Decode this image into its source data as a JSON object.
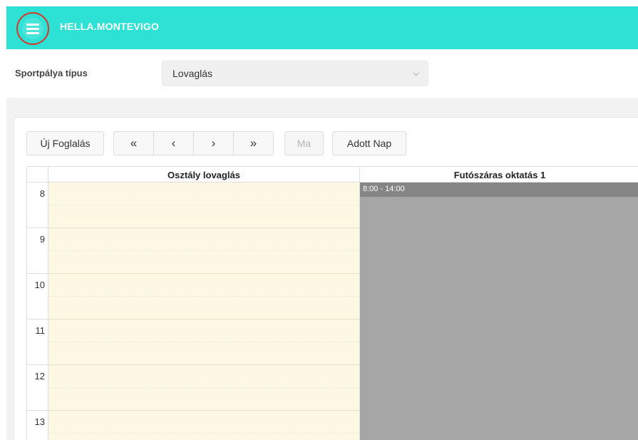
{
  "header": {
    "brand": "HELLA.MONTEVIGO",
    "menu_icon": "hamburger-menu-icon",
    "color": "#2de2d5"
  },
  "filter": {
    "label": "Sportpálya típus",
    "selected": "Lovaglás"
  },
  "toolbar": {
    "new_booking": "Új Foglalás",
    "first": "«",
    "prev": "‹",
    "next": "›",
    "last": "»",
    "today": "Ma",
    "given_day": "Adott Nap"
  },
  "calendar": {
    "columns": [
      "Osztály lovaglás",
      "Futószáras oktatás 1"
    ],
    "hours": [
      "8",
      "9",
      "10",
      "11",
      "12",
      "13"
    ],
    "event": {
      "label": "8:00 - 14:00",
      "color": "#858585"
    },
    "free_color": "#fcf8e3",
    "blocked_color": "#a6a6a6"
  }
}
